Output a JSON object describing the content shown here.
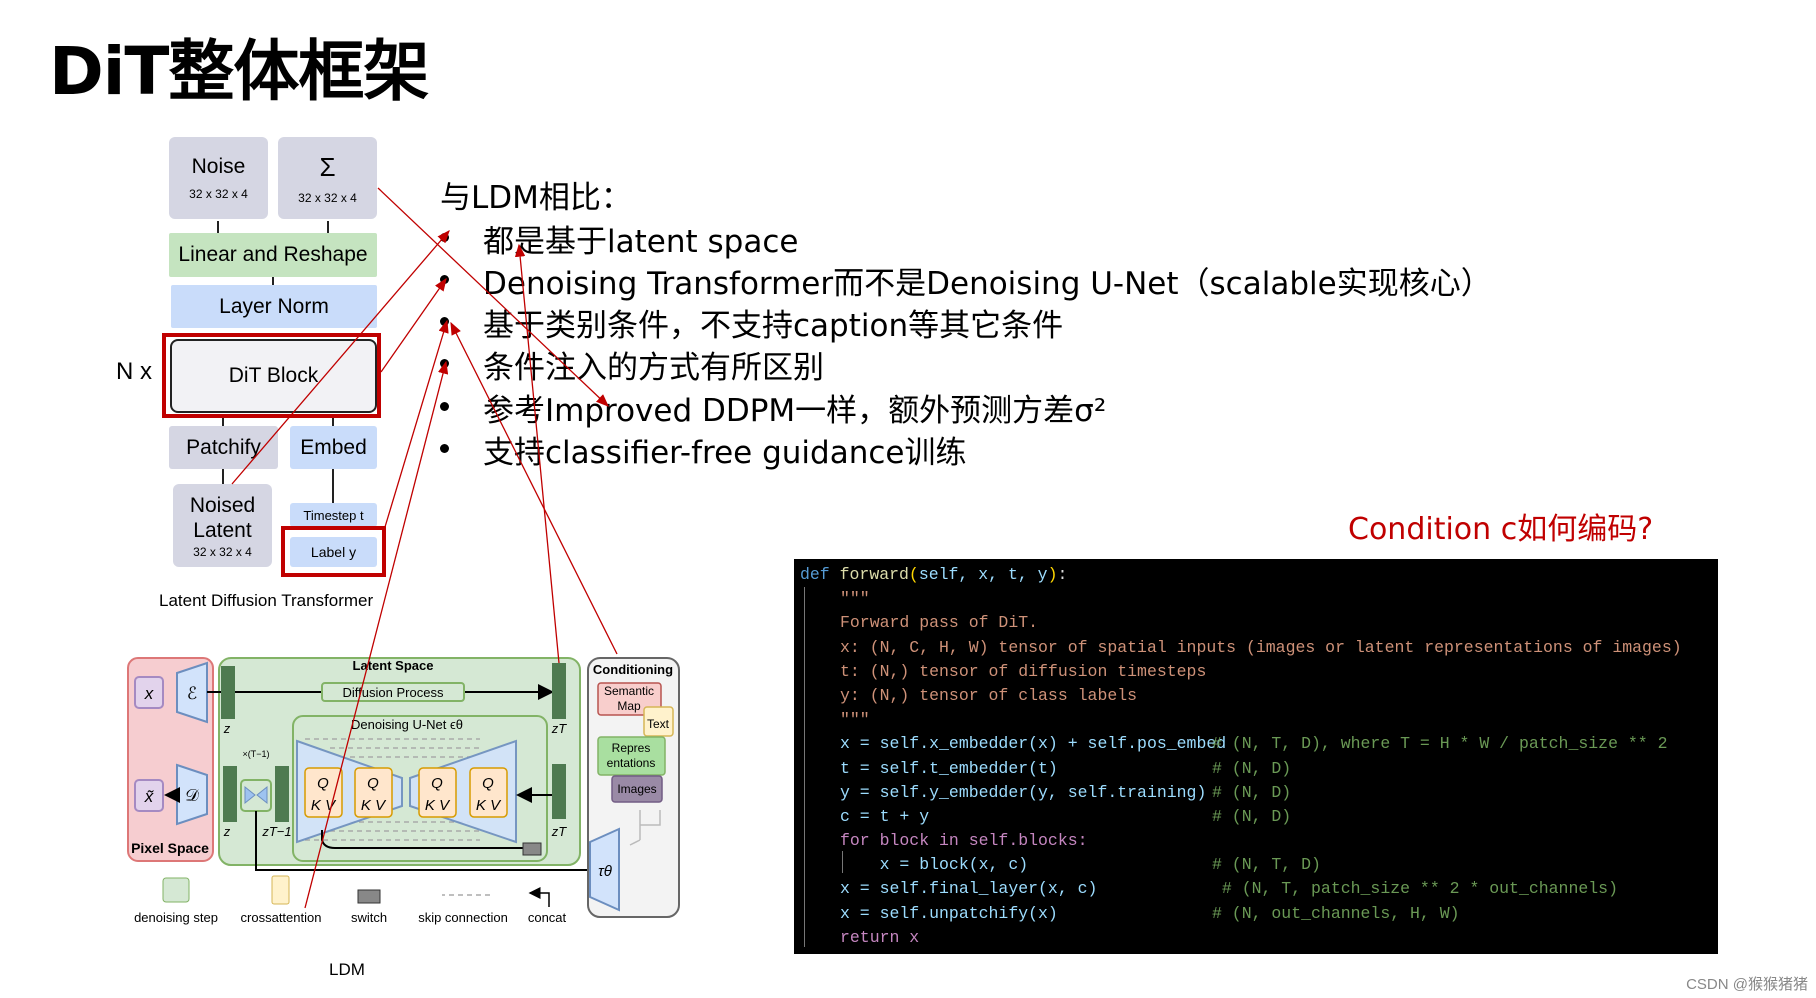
{
  "title": "DiT整体框架",
  "dit_diagram": {
    "noise": {
      "label": "Noise",
      "dim": "32 x 32 x 4"
    },
    "sigma": {
      "label": "Σ",
      "dim": "32 x 32 x 4"
    },
    "linear_reshape": "Linear and Reshape",
    "layer_norm": "Layer Norm",
    "dit_block": "DiT Block",
    "n_x": "N x",
    "patchify": "Patchify",
    "embed": "Embed",
    "noised_latent": {
      "line1": "Noised",
      "line2": "Latent",
      "dim": "32 x 32 x 4"
    },
    "timestep": "Timestep t",
    "label": "Label y",
    "caption": "Latent Diffusion Transformer"
  },
  "comparison": {
    "heading": "与LDM相比：",
    "bullets": [
      "都是基于latent space",
      "Denoising Transformer而不是Denoising U-Net（scalable实现核心）",
      "基于类别条件，不支持caption等其它条件",
      "条件注入的方式有所区别",
      "参考Improved DDPM一样，额外预测方差σ²",
      "支持classifier-free guidance训练"
    ]
  },
  "condition_question": "Condition c如何编码?",
  "code": {
    "l1": {
      "def": "def ",
      "fn": "forward",
      "p1": "(",
      "args": "self, x, t, y",
      "p2": ")",
      "colon": ":"
    },
    "doc_quote": "\"\"\"",
    "doc": [
      "Forward pass of DiT.",
      "x: (N, C, H, W) tensor of spatial inputs (images or latent representations of images)",
      "t: (N,) tensor of diffusion timesteps",
      "y: (N,) tensor of class labels"
    ],
    "body": [
      {
        "code": "x = self.x_embedder(x) + self.pos_embed",
        "comment": "# (N, T, D), where T = H * W / patch_size ** 2"
      },
      {
        "code": "t = self.t_embedder(t)",
        "comment": "# (N, D)"
      },
      {
        "code": "y = self.y_embedder(y, self.training)",
        "comment": "# (N, D)"
      },
      {
        "code": "c = t + y",
        "comment": "# (N, D)"
      },
      {
        "code": "for block in self.blocks:",
        "comment": ""
      },
      {
        "code": "    x = block(x, c)",
        "comment": "# (N, T, D)"
      },
      {
        "code": "x = self.final_layer(x, c)",
        "comment": " # (N, T, patch_size ** 2 * out_channels)"
      },
      {
        "code": "x = self.unpatchify(x)",
        "comment": "# (N, out_channels, H, W)"
      },
      {
        "code": "return x",
        "comment": ""
      }
    ]
  },
  "ldm": {
    "pixel_space": "Pixel Space",
    "latent_space": "Latent Space",
    "diffusion_process": "Diffusion Process",
    "unet": "Denoising U-Net ϵθ",
    "x": "x",
    "x_tilde": "x̃",
    "encoder": "ℰ",
    "decoder": "𝒟",
    "z": "z",
    "zT": "zT",
    "zT1": "zT−1",
    "times": "×(T−1)",
    "q": "Q",
    "kv": "K V",
    "conditioning": "Conditioning",
    "semantic_map": [
      "Semantic",
      "Map"
    ],
    "text": "Text",
    "representations": [
      "Repres",
      "entations"
    ],
    "images": "Images",
    "tau": "τθ",
    "legend": [
      "denoising step",
      "crossattention",
      "switch",
      "skip connection",
      "concat"
    ],
    "caption": "LDM"
  },
  "watermark": "CSDN @猴猴猪猪",
  "colors": {
    "accent_red": "#c00000",
    "code_bg": "#000000"
  }
}
